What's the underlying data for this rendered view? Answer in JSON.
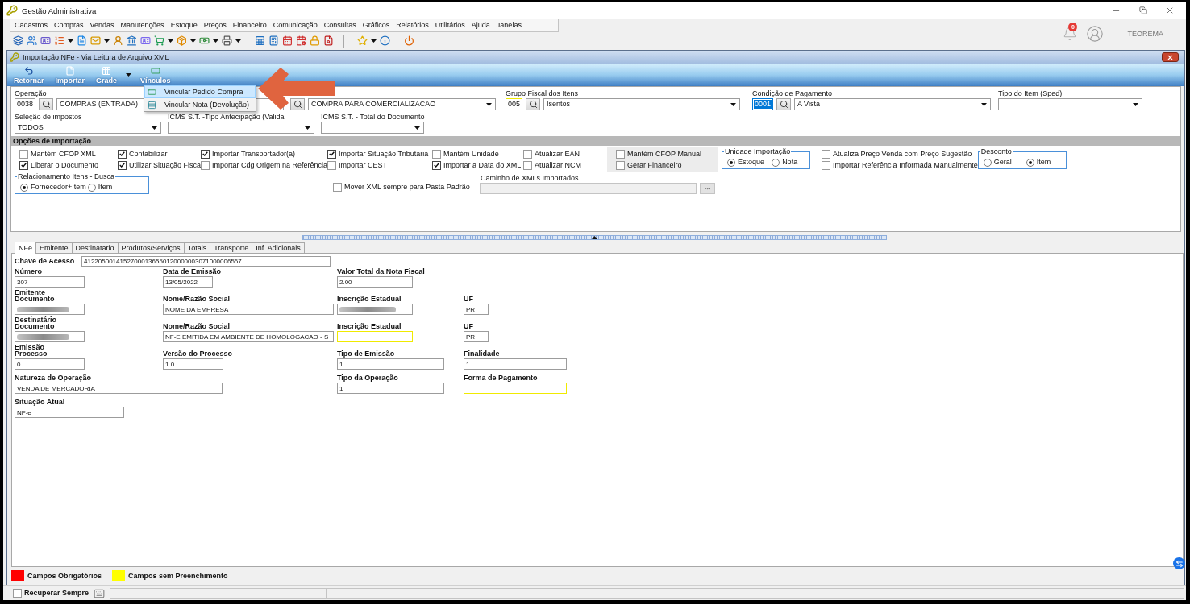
{
  "app_window": {
    "title": "Gestão Administrativa"
  },
  "menu_bar": [
    "Cadastros",
    "Compras",
    "Vendas",
    "Manutenções",
    "Estoque",
    "Preços",
    "Financeiro",
    "Comunicação",
    "Consultas",
    "Gráficos",
    "Relatórios",
    "Utilitários",
    "Ajuda",
    "Janelas"
  ],
  "user_area": {
    "notification_count": "0",
    "user_name": "TEOREMA"
  },
  "document_window": {
    "title": "Importação NFe - Via Leitura de Arquivo XML"
  },
  "ribbon": [
    {
      "label": "Retornar",
      "kind": "button"
    },
    {
      "label": "Importar",
      "kind": "button"
    },
    {
      "label": "Grade",
      "kind": "button"
    },
    {
      "label": "Vínculos",
      "kind": "menu",
      "expanded": true
    }
  ],
  "links_menu": [
    {
      "label": "Vincular Pedido Compra",
      "selected": true
    },
    {
      "label": "Vincular Nota (Devolução)",
      "selected": false
    }
  ],
  "header_fields": [
    [
      {
        "label": "Operação",
        "parts": [
          {
            "kind": "code",
            "text": "0038",
            "unfilled": false,
            "selected": false
          },
          {
            "kind": "search"
          },
          {
            "kind": "text",
            "text": "COMPRAS (ENTRADA)"
          }
        ]
      },
      {
        "parts": [
          {
            "kind": "search"
          },
          {
            "kind": "select",
            "text": "COMPRA PARA COMERCIALIZACAO"
          }
        ]
      },
      {
        "label": "Grupo Fiscal dos Itens",
        "parts": [
          {
            "kind": "code",
            "text": "005",
            "unfilled": true,
            "selected": false
          },
          {
            "kind": "search"
          },
          {
            "kind": "select",
            "text": "Isentos"
          }
        ]
      },
      {
        "label": "Condição de Pagamento",
        "parts": [
          {
            "kind": "code",
            "text": "0001",
            "unfilled": false,
            "selected": true
          },
          {
            "kind": "search"
          },
          {
            "kind": "select",
            "text": "A Vista"
          }
        ]
      },
      {
        "label": "Tipo do Item (Sped)",
        "parts": [
          {
            "kind": "select"
          }
        ]
      }
    ],
    [
      {
        "label": "Seleção de impostos",
        "parts": [
          {
            "kind": "select",
            "text": "TODOS"
          }
        ]
      },
      {
        "label": "ICMS S.T. -Tipo Antecipação (Valida",
        "parts": [
          {
            "kind": "select"
          }
        ]
      },
      {
        "label": "ICMS S.T. - Total do Documento",
        "parts": [
          {
            "kind": "select"
          }
        ]
      }
    ]
  ],
  "import_options": {
    "title": "Opções de Importação",
    "columns": [
      {
        "kind": "checks",
        "items": [
          {
            "label": "Mantém CFOP XML",
            "checked": false
          },
          {
            "label": "Liberar o Documento",
            "checked": true
          }
        ]
      },
      {
        "kind": "checks",
        "items": [
          {
            "label": "Contabilizar",
            "checked": true
          },
          {
            "label": "Utilizar Situação Fisca",
            "checked": true
          }
        ]
      },
      {
        "kind": "checks",
        "items": [
          {
            "label": "Importar Transportador(a)",
            "checked": true
          },
          {
            "label": "Importar Cdg Origem na Referência",
            "checked": false
          }
        ]
      },
      {
        "kind": "checks",
        "items": [
          {
            "label": "Importar Situação Tributária",
            "checked": true
          },
          {
            "label": "Importar CEST",
            "checked": false
          }
        ]
      },
      {
        "kind": "checks",
        "items": [
          {
            "label": "Mantém Unidade",
            "checked": false
          },
          {
            "label": "Importar a Data do XML",
            "checked": true
          }
        ]
      },
      {
        "kind": "checks",
        "items": [
          {
            "label": "Atualizar EAN",
            "checked": false
          },
          {
            "label": "Atualizar NCM",
            "checked": false
          }
        ]
      },
      {
        "kind": "checks_panel",
        "items": [
          {
            "label": "Mantém CFOP Manual",
            "checked": false
          },
          {
            "label": "Gerar Financeiro",
            "checked": false
          }
        ]
      },
      {
        "kind": "radios",
        "title": "Unidade Importação",
        "options": [
          {
            "label": "Estoque",
            "selected": true
          },
          {
            "label": "Nota",
            "selected": false
          }
        ]
      },
      {
        "kind": "checks",
        "items": [
          {
            "label": "Atualiza Preço Venda com Preço Sugestão",
            "checked": false
          },
          {
            "label": "Importar Referência Informada Manualmente",
            "checked": false
          }
        ]
      },
      {
        "kind": "radios",
        "title": "Desconto",
        "options": [
          {
            "label": "Geral",
            "selected": false
          },
          {
            "label": "Item",
            "selected": true
          }
        ]
      }
    ],
    "search_relation": {
      "title": "Relacionamento Itens - Busca",
      "options": [
        {
          "label": "Fornecedor+Item",
          "selected": true
        },
        {
          "label": "Item",
          "selected": false
        }
      ]
    },
    "move_xml": {
      "label": "Mover XML sempre para Pasta Padrão",
      "checked": false
    },
    "xml_path": {
      "label": "Caminho de XMLs Importados",
      "disabled": true
    }
  },
  "tabs": [
    {
      "label": "NFe",
      "selected": true
    },
    {
      "label": "Emitente",
      "selected": false
    },
    {
      "label": "Destinatario",
      "selected": false
    },
    {
      "label": "Produtos/Serviços",
      "selected": false
    },
    {
      "label": "Totais",
      "selected": false
    },
    {
      "label": "Transporte",
      "selected": false
    },
    {
      "label": "Inf. Adicionais",
      "selected": false
    }
  ],
  "nfe_form": {
    "access_key": {
      "label": "Chave de Acesso",
      "value": "41220500141527000136550120000003071000006567"
    },
    "rows": [
      {
        "fields": [
          {
            "label": "Número",
            "value": "307",
            "unfilled": false,
            "redacted": false
          },
          {
            "label": "Data de Emissão",
            "value": "13/05/2022",
            "unfilled": false,
            "redacted": false
          },
          {
            "label": "Valor Total da Nota Fiscal",
            "value": "2.00",
            "unfilled": false,
            "redacted": false
          }
        ]
      },
      {
        "section": "Emitente",
        "fields": [
          {
            "label": "Documento",
            "unfilled": false,
            "redacted": true
          },
          {
            "label": "Nome/Razão Social",
            "value": "NOME DA EMPRESA",
            "unfilled": false,
            "redacted": false
          },
          {
            "label": "Inscrição Estadual",
            "unfilled": false,
            "redacted": true
          },
          {
            "label": "UF",
            "value": "PR",
            "unfilled": false,
            "redacted": false
          }
        ]
      },
      {
        "section": "Destinatário",
        "fields": [
          {
            "label": "Documento",
            "unfilled": false,
            "redacted": true
          },
          {
            "label": "Nome/Razão Social",
            "value": "NF-E EMITIDA EM AMBIENTE DE HOMOLOGACAO - S",
            "unfilled": false,
            "redacted": false
          },
          {
            "label": "Inscrição Estadual",
            "unfilled": true,
            "redacted": false
          },
          {
            "label": "UF",
            "value": "PR",
            "unfilled": false,
            "redacted": false
          }
        ]
      },
      {
        "section": "Emissão",
        "fields": [
          {
            "label": "Processo",
            "value": "0",
            "unfilled": false,
            "redacted": false
          },
          {
            "label": "Versão do Processo",
            "value": "1.0",
            "unfilled": false,
            "redacted": false
          },
          {
            "label": "Tipo de Emissão",
            "value": "1",
            "unfilled": false,
            "redacted": false
          },
          {
            "label": "Finalidade",
            "value": "1",
            "unfilled": false,
            "redacted": false
          }
        ]
      },
      {
        "fields": [
          {
            "label": "Natureza de Operação",
            "value": "VENDA DE MERCADORIA",
            "unfilled": false,
            "redacted": false
          },
          {
            "label": "Tipo da Operação",
            "value": "1",
            "unfilled": false,
            "redacted": false
          },
          {
            "label": "Forma de Pagamento",
            "unfilled": true,
            "redacted": false
          }
        ]
      },
      {
        "fields": [
          {
            "label": "Situação Atual",
            "value": "NF-e",
            "unfilled": false,
            "redacted": false
          }
        ]
      }
    ]
  },
  "legend": [
    {
      "label": "Campos Obrigatórios",
      "color": "#ff0000"
    },
    {
      "label": "Campos sem Preenchimento",
      "color": "#ffff00"
    }
  ],
  "status_bar": {
    "recover_always": {
      "label": "Recuperar Sempre",
      "checked": false
    }
  }
}
